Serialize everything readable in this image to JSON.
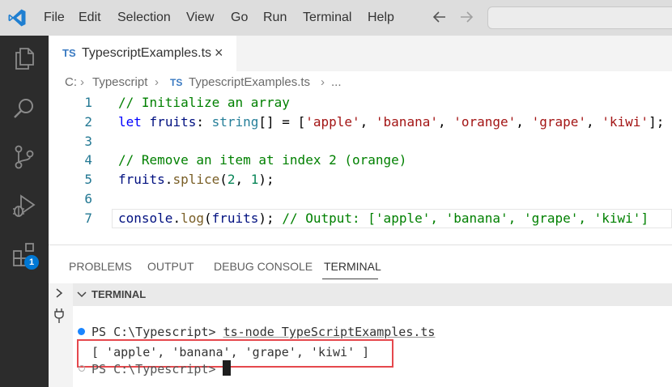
{
  "menu": {
    "items": [
      "File",
      "Edit",
      "Selection",
      "View",
      "Go",
      "Run",
      "Terminal",
      "Help"
    ]
  },
  "tab": {
    "badge": "TS",
    "label": "TypescriptExamples.ts",
    "close": "×"
  },
  "breadcrumb": {
    "drive": "C:",
    "folder": "Typescript",
    "badge": "TS",
    "file": "TypescriptExamples.ts",
    "more": "..."
  },
  "editor": {
    "line_numbers": [
      "1",
      "2",
      "3",
      "4",
      "5",
      "6",
      "7"
    ],
    "lines": {
      "l1_comment": "// Initialize an array",
      "l2_let": "let",
      "l2_var": "fruits",
      "l2_colon": ": ",
      "l2_type": "string",
      "l2_eq": "[] = [",
      "l2_s1": "'apple'",
      "l2_s2": "'banana'",
      "l2_s3": "'orange'",
      "l2_s4": "'grape'",
      "l2_s5": "'kiwi'",
      "l2_end": "];",
      "l4_comment": "// Remove an item at index 2 (orange)",
      "l5_var": "fruits",
      "l5_dot": ".",
      "l5_fn": "splice",
      "l5_open": "(",
      "l5_n1": "2",
      "l5_comma": ", ",
      "l5_n2": "1",
      "l5_end": ");",
      "l7_obj": "console",
      "l7_dot": ".",
      "l7_fn": "log",
      "l7_open": "(",
      "l7_var": "fruits",
      "l7_end": "); ",
      "l7_comment": "// Output: ['apple', 'banana', 'grape', 'kiwi']"
    }
  },
  "activity": {
    "extensions_badge": "1"
  },
  "panel": {
    "tabs": [
      "PROBLEMS",
      "OUTPUT",
      "DEBUG CONSOLE",
      "TERMINAL"
    ],
    "active_tab": "TERMINAL",
    "section_label": "TERMINAL"
  },
  "terminal": {
    "prompt": "PS C:\\Typescript>",
    "command": "ts-node TypeScriptExamples.ts",
    "output": "[ 'apple', 'banana', 'grape', 'kiwi' ]",
    "prompt2": "PS C:\\Typescript>"
  },
  "colors": {
    "accent": "#0078d4",
    "highlight_box": "#e5484d",
    "activity_bar": "#2c2c2c"
  }
}
